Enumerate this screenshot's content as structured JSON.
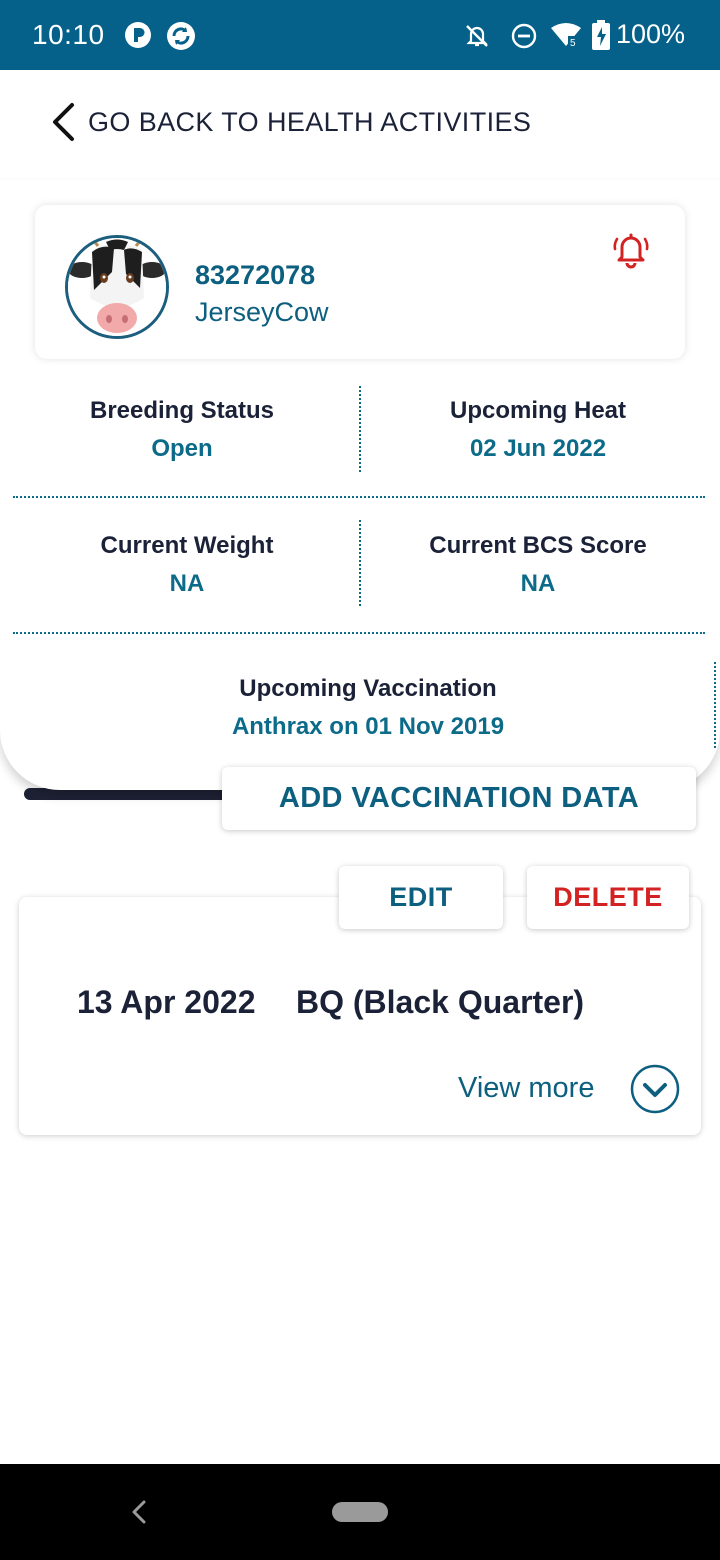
{
  "status_bar": {
    "time": "10:10",
    "battery": "100%",
    "wifi_badge": "5",
    "icons": [
      "app-p-icon",
      "app-sync-icon",
      "bell-off-icon",
      "do-not-disturb-icon",
      "wifi-icon",
      "battery-charging-icon"
    ]
  },
  "nav": {
    "back_label": "GO BACK TO HEALTH ACTIVITIES"
  },
  "animal": {
    "id": "83272078",
    "breed": "JerseyCow",
    "alert_icon": "alarm-bell-icon"
  },
  "stats": {
    "breeding_status": {
      "label": "Breeding Status",
      "value": "Open"
    },
    "upcoming_heat": {
      "label": "Upcoming Heat",
      "value": "02 Jun 2022"
    },
    "current_weight": {
      "label": "Current Weight",
      "value": "NA"
    },
    "current_bcs": {
      "label": "Current BCS Score",
      "value": "NA"
    },
    "upcoming_vaccination": {
      "label": "Upcoming Vaccination",
      "value": "Anthrax on 01 Nov 2019"
    }
  },
  "actions": {
    "add_vaccination": "ADD VACCINATION DATA",
    "edit": "EDIT",
    "delete": "DELETE"
  },
  "record": {
    "date": "13 Apr 2022",
    "name": "BQ (Black Quarter)",
    "view_more": "View more"
  },
  "colors": {
    "status_bar": "#05618a",
    "accent": "#0d5f80",
    "danger": "#d32222",
    "text_dark": "#1b2238"
  }
}
